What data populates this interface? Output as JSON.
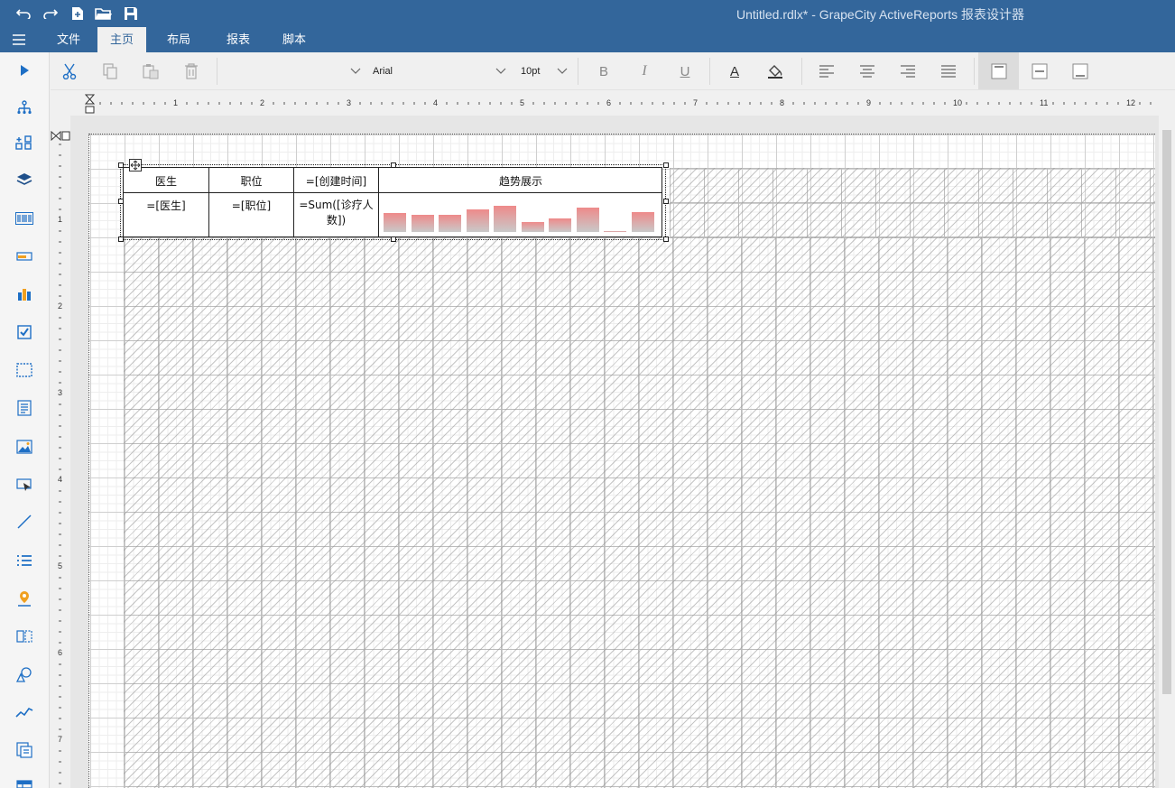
{
  "window": {
    "title": "Untitled.rdlx* - GrapeCity ActiveReports 报表设计器"
  },
  "quick_access": [
    "undo-icon",
    "redo-icon",
    "new-file-icon",
    "open-folder-icon",
    "save-icon"
  ],
  "menu": {
    "tabs": [
      {
        "label": "文件",
        "active": false
      },
      {
        "label": "主页",
        "active": true
      },
      {
        "label": "布局",
        "active": false
      },
      {
        "label": "报表",
        "active": false
      },
      {
        "label": "脚本",
        "active": false
      }
    ]
  },
  "toolbar": {
    "font_family": "Arial",
    "font_size": "10pt",
    "bold": "B",
    "italic": "I",
    "underline": "U",
    "font_color_glyph": "A"
  },
  "ruler": {
    "horizontal": [
      "1",
      "2",
      "3",
      "4",
      "5",
      "6",
      "7",
      "8",
      "9",
      "10",
      "11",
      "12"
    ],
    "vertical": [
      "1",
      "2",
      "3",
      "4",
      "5",
      "6",
      "7"
    ]
  },
  "table": {
    "headers": [
      "医生",
      "职位",
      "=[创建时间]",
      "趋势展示"
    ],
    "detail": [
      "=[医生]",
      "=[职位]",
      "=Sum([诊疗人数])"
    ]
  },
  "sparkline": {
    "values": [
      0.52,
      0.48,
      0.48,
      0.62,
      0.72,
      0.27,
      0.37,
      0.68,
      0.02,
      0.55
    ],
    "bar_color_top": "#ee8a8a",
    "bar_color_bottom": "#c9c9c9"
  },
  "colors": {
    "accent": "#33669b"
  }
}
